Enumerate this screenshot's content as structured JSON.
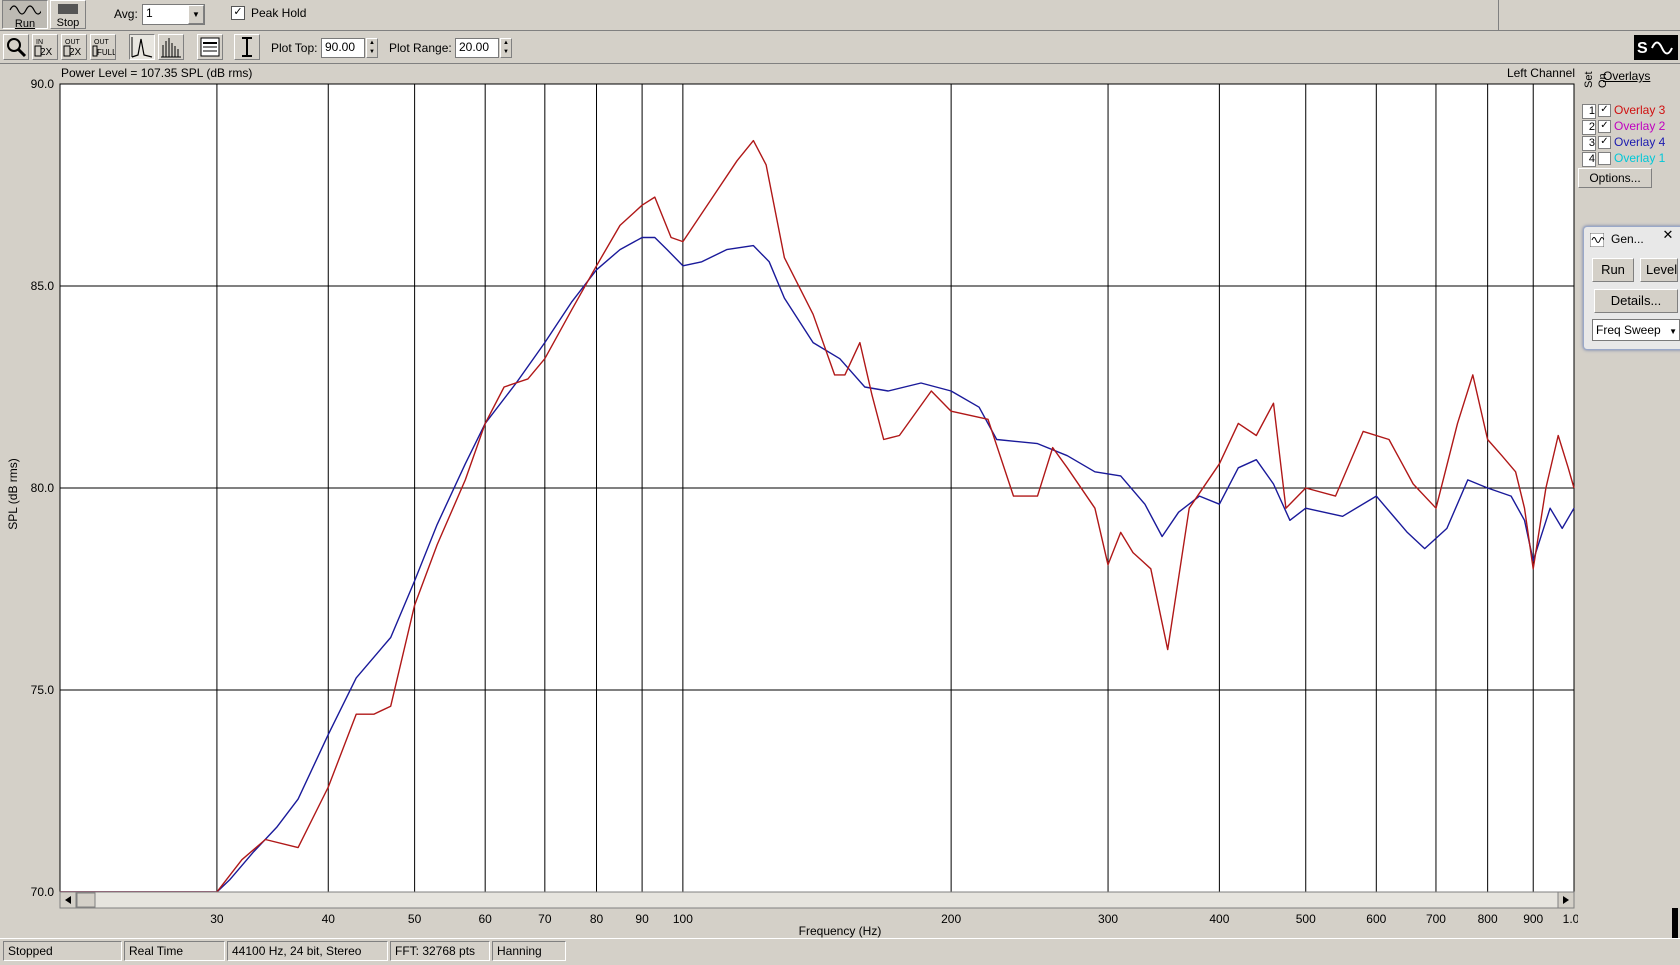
{
  "toolbar1": {
    "run_label": "Run",
    "stop_label": "Stop",
    "avg_label": "Avg:",
    "avg_value": "1",
    "peak_hold_label": "Peak Hold",
    "peak_hold_checked": true
  },
  "toolbar2": {
    "plot_top_label": "Plot Top:",
    "plot_top_value": "90.00",
    "plot_range_label": "Plot Range:",
    "plot_range_value": "20.00"
  },
  "plot_header": {
    "power_level": "Power Level = 107.35 SPL (dB rms)",
    "channel": "Left Channel"
  },
  "overlays": {
    "title": "Overlays",
    "col_set": "Set",
    "col_on": "On",
    "items": [
      {
        "num": "1",
        "checked": true,
        "label": "Overlay 3",
        "color": "#d01010"
      },
      {
        "num": "2",
        "checked": true,
        "label": "Overlay 2",
        "color": "#c000c0"
      },
      {
        "num": "3",
        "checked": true,
        "label": "Overlay 4",
        "color": "#1a1ab0"
      },
      {
        "num": "4",
        "checked": false,
        "label": "Overlay 1",
        "color": "#00c8d8"
      }
    ],
    "options_label": "Options..."
  },
  "generator": {
    "title": "Gen...",
    "run_label": "Run",
    "level_label": "Level",
    "details_label": "Details...",
    "mode_value": "Freq Sweep"
  },
  "status": {
    "state": "Stopped",
    "mode": "Real Time",
    "format": "44100 Hz, 24 bit, Stereo",
    "fft": "FFT: 32768 pts",
    "window": "Hanning"
  },
  "chart_data": {
    "type": "line",
    "xlabel": "Frequency (Hz)",
    "ylabel": "SPL (dB rms)",
    "xscale": "log",
    "xlim": [
      20,
      1000
    ],
    "ylim": [
      70,
      90
    ],
    "x_ticks": [
      {
        "v": 30,
        "label": "30"
      },
      {
        "v": 40,
        "label": "40"
      },
      {
        "v": 50,
        "label": "50"
      },
      {
        "v": 60,
        "label": "60"
      },
      {
        "v": 70,
        "label": "70"
      },
      {
        "v": 80,
        "label": "80"
      },
      {
        "v": 90,
        "label": "90"
      },
      {
        "v": 100,
        "label": "100"
      },
      {
        "v": 200,
        "label": "200"
      },
      {
        "v": 300,
        "label": "300"
      },
      {
        "v": 400,
        "label": "400"
      },
      {
        "v": 500,
        "label": "500"
      },
      {
        "v": 600,
        "label": "600"
      },
      {
        "v": 700,
        "label": "700"
      },
      {
        "v": 800,
        "label": "800"
      },
      {
        "v": 900,
        "label": "900"
      },
      {
        "v": 1000,
        "label": "1.0k"
      }
    ],
    "y_ticks": [
      {
        "v": 70,
        "label": "70.0"
      },
      {
        "v": 75,
        "label": "75.0"
      },
      {
        "v": 80,
        "label": "80.0"
      },
      {
        "v": 85,
        "label": "85.0"
      },
      {
        "v": 90,
        "label": "90.0"
      }
    ],
    "grid": true,
    "series": [
      {
        "name": "Overlay 4",
        "color": "#1a1a9a",
        "points": [
          [
            20,
            70.0
          ],
          [
            30,
            70.0
          ],
          [
            31,
            70.3
          ],
          [
            33,
            71.0
          ],
          [
            35,
            71.6
          ],
          [
            37,
            72.3
          ],
          [
            40,
            73.9
          ],
          [
            43,
            75.3
          ],
          [
            47,
            76.3
          ],
          [
            50,
            77.7
          ],
          [
            53,
            79.1
          ],
          [
            57,
            80.6
          ],
          [
            60,
            81.6
          ],
          [
            65,
            82.6
          ],
          [
            70,
            83.6
          ],
          [
            75,
            84.6
          ],
          [
            80,
            85.4
          ],
          [
            85,
            85.9
          ],
          [
            90,
            86.2
          ],
          [
            93,
            86.2
          ],
          [
            96,
            85.9
          ],
          [
            100,
            85.5
          ],
          [
            105,
            85.6
          ],
          [
            112,
            85.9
          ],
          [
            120,
            86.0
          ],
          [
            125,
            85.6
          ],
          [
            130,
            84.7
          ],
          [
            140,
            83.6
          ],
          [
            150,
            83.2
          ],
          [
            160,
            82.5
          ],
          [
            170,
            82.4
          ],
          [
            185,
            82.6
          ],
          [
            200,
            82.4
          ],
          [
            215,
            82.0
          ],
          [
            225,
            81.2
          ],
          [
            250,
            81.1
          ],
          [
            270,
            80.8
          ],
          [
            290,
            80.4
          ],
          [
            310,
            80.3
          ],
          [
            330,
            79.6
          ],
          [
            345,
            78.8
          ],
          [
            360,
            79.4
          ],
          [
            380,
            79.8
          ],
          [
            400,
            79.6
          ],
          [
            420,
            80.5
          ],
          [
            440,
            80.7
          ],
          [
            460,
            80.1
          ],
          [
            480,
            79.2
          ],
          [
            500,
            79.5
          ],
          [
            550,
            79.3
          ],
          [
            600,
            79.8
          ],
          [
            650,
            78.9
          ],
          [
            680,
            78.5
          ],
          [
            720,
            79.0
          ],
          [
            760,
            80.2
          ],
          [
            800,
            80.0
          ],
          [
            850,
            79.8
          ],
          [
            880,
            79.2
          ],
          [
            900,
            78.2
          ],
          [
            940,
            79.5
          ],
          [
            970,
            79.0
          ],
          [
            1000,
            79.5
          ]
        ]
      },
      {
        "name": "Overlay 3",
        "color": "#b01818",
        "points": [
          [
            20,
            70.0
          ],
          [
            30,
            70.0
          ],
          [
            32,
            70.8
          ],
          [
            34,
            71.3
          ],
          [
            37,
            71.1
          ],
          [
            40,
            72.6
          ],
          [
            43,
            74.4
          ],
          [
            45,
            74.4
          ],
          [
            47,
            74.6
          ],
          [
            50,
            77.1
          ],
          [
            53,
            78.6
          ],
          [
            57,
            80.2
          ],
          [
            60,
            81.6
          ],
          [
            63,
            82.5
          ],
          [
            67,
            82.7
          ],
          [
            70,
            83.2
          ],
          [
            75,
            84.4
          ],
          [
            80,
            85.5
          ],
          [
            85,
            86.5
          ],
          [
            90,
            87.0
          ],
          [
            93,
            87.2
          ],
          [
            97,
            86.2
          ],
          [
            100,
            86.1
          ],
          [
            108,
            87.2
          ],
          [
            115,
            88.1
          ],
          [
            120,
            88.6
          ],
          [
            124,
            88.0
          ],
          [
            130,
            85.7
          ],
          [
            140,
            84.3
          ],
          [
            148,
            82.8
          ],
          [
            152,
            82.8
          ],
          [
            158,
            83.6
          ],
          [
            163,
            82.3
          ],
          [
            168,
            81.2
          ],
          [
            175,
            81.3
          ],
          [
            190,
            82.4
          ],
          [
            200,
            81.9
          ],
          [
            220,
            81.7
          ],
          [
            235,
            79.8
          ],
          [
            250,
            79.8
          ],
          [
            260,
            81.0
          ],
          [
            270,
            80.5
          ],
          [
            290,
            79.5
          ],
          [
            300,
            78.1
          ],
          [
            310,
            78.9
          ],
          [
            320,
            78.4
          ],
          [
            335,
            78.0
          ],
          [
            350,
            76.0
          ],
          [
            370,
            79.5
          ],
          [
            400,
            80.6
          ],
          [
            420,
            81.6
          ],
          [
            440,
            81.3
          ],
          [
            460,
            82.1
          ],
          [
            475,
            79.5
          ],
          [
            500,
            80.0
          ],
          [
            540,
            79.8
          ],
          [
            580,
            81.4
          ],
          [
            620,
            81.2
          ],
          [
            660,
            80.1
          ],
          [
            700,
            79.5
          ],
          [
            740,
            81.6
          ],
          [
            770,
            82.8
          ],
          [
            800,
            81.2
          ],
          [
            830,
            80.8
          ],
          [
            860,
            80.4
          ],
          [
            880,
            79.5
          ],
          [
            900,
            78.0
          ],
          [
            930,
            80.0
          ],
          [
            960,
            81.3
          ],
          [
            985,
            80.5
          ],
          [
            1000,
            80.0
          ]
        ]
      }
    ]
  }
}
